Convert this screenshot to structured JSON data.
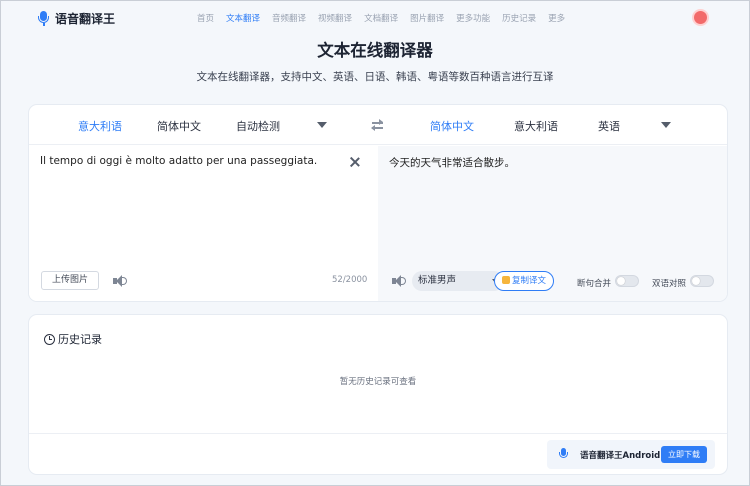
{
  "header": {
    "logo_text": "语音翻译王",
    "nav": [
      "首页",
      "文本翻译",
      "音频翻译",
      "视频翻译",
      "文档翻译",
      "图片翻译",
      "更多功能",
      "历史记录",
      "更多"
    ],
    "active_nav_index": 1
  },
  "page": {
    "title": "文本在线翻译器",
    "subtitle": "文本在线翻译器，支持中文、英语、日语、韩语、粤语等数百种语言进行互译"
  },
  "source_langs": [
    "意大利语",
    "简体中文",
    "自动检测"
  ],
  "target_langs": [
    "简体中文",
    "意大利语",
    "英语"
  ],
  "source": {
    "text": "Il tempo di oggi è molto adatto per una passeggiata.",
    "upload_label": "上传图片",
    "count": "52/2000"
  },
  "target": {
    "text": "今天的天气非常适合散步。",
    "voice": "标准男声",
    "copy_label": "复制译文",
    "merge_label": "断句合并",
    "compare_label": "双语对照"
  },
  "history": {
    "title": "历史记录",
    "empty_text": "暂无历史记录可查看",
    "app_label": "语音翻译王Android",
    "download_label": "立即下载"
  },
  "colors": {
    "accent": "#2f7df6"
  }
}
